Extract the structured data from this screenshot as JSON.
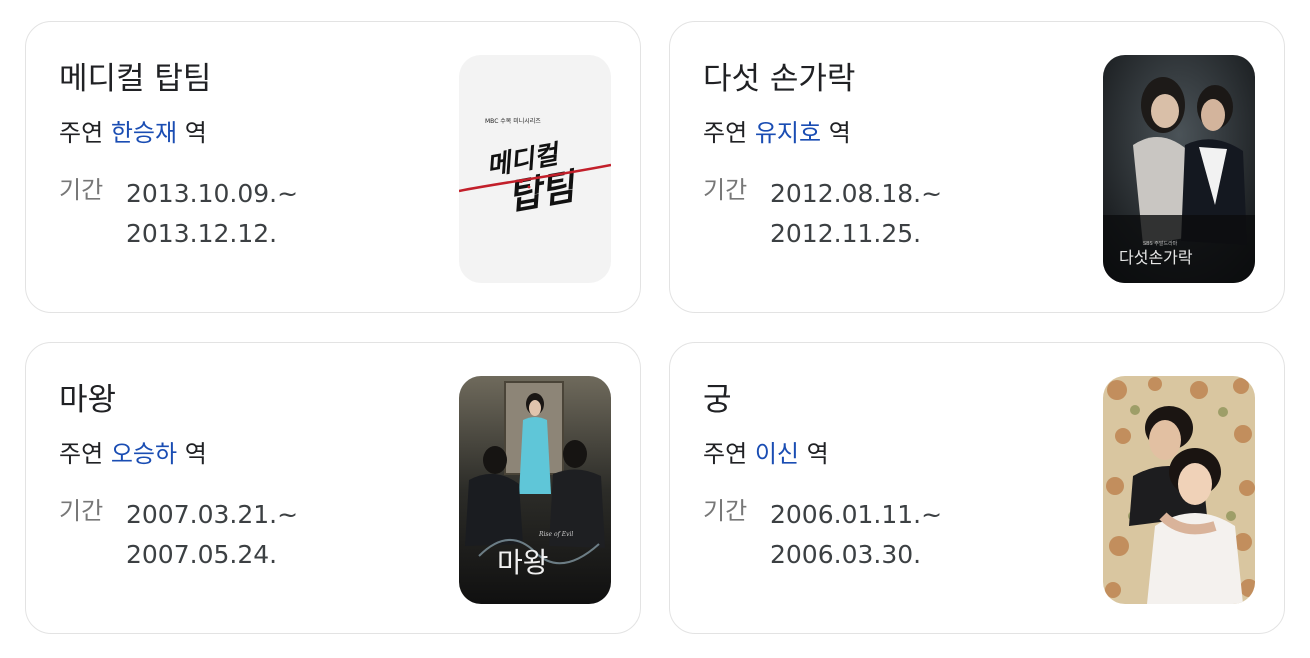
{
  "role_prefix": "주연",
  "role_suffix": "역",
  "period_label": "기간",
  "cards": [
    {
      "title": "메디컬 탑팀",
      "actor": "한승재",
      "period_start": "2013.10.09.~",
      "period_end": "2013.12.12.",
      "poster": {
        "channel_text": "MBC 수목 미니시리즈",
        "title_line1": "메디컬",
        "title_line2": "탑팀"
      }
    },
    {
      "title": "다섯 손가락",
      "actor": "유지호",
      "period_start": "2012.08.18.~",
      "period_end": "2012.11.25.",
      "poster": {
        "channel_text": "SBS 주말드라마",
        "title_line1": "다섯손가락"
      }
    },
    {
      "title": "마왕",
      "actor": "오승하",
      "period_start": "2007.03.21.~",
      "period_end": "2007.05.24.",
      "poster": {
        "script_text": "Rise of Evil",
        "title_line1": "마왕"
      }
    },
    {
      "title": "궁",
      "actor": "이신",
      "period_start": "2006.01.11.~",
      "period_end": "2006.03.30.",
      "poster": {}
    }
  ]
}
